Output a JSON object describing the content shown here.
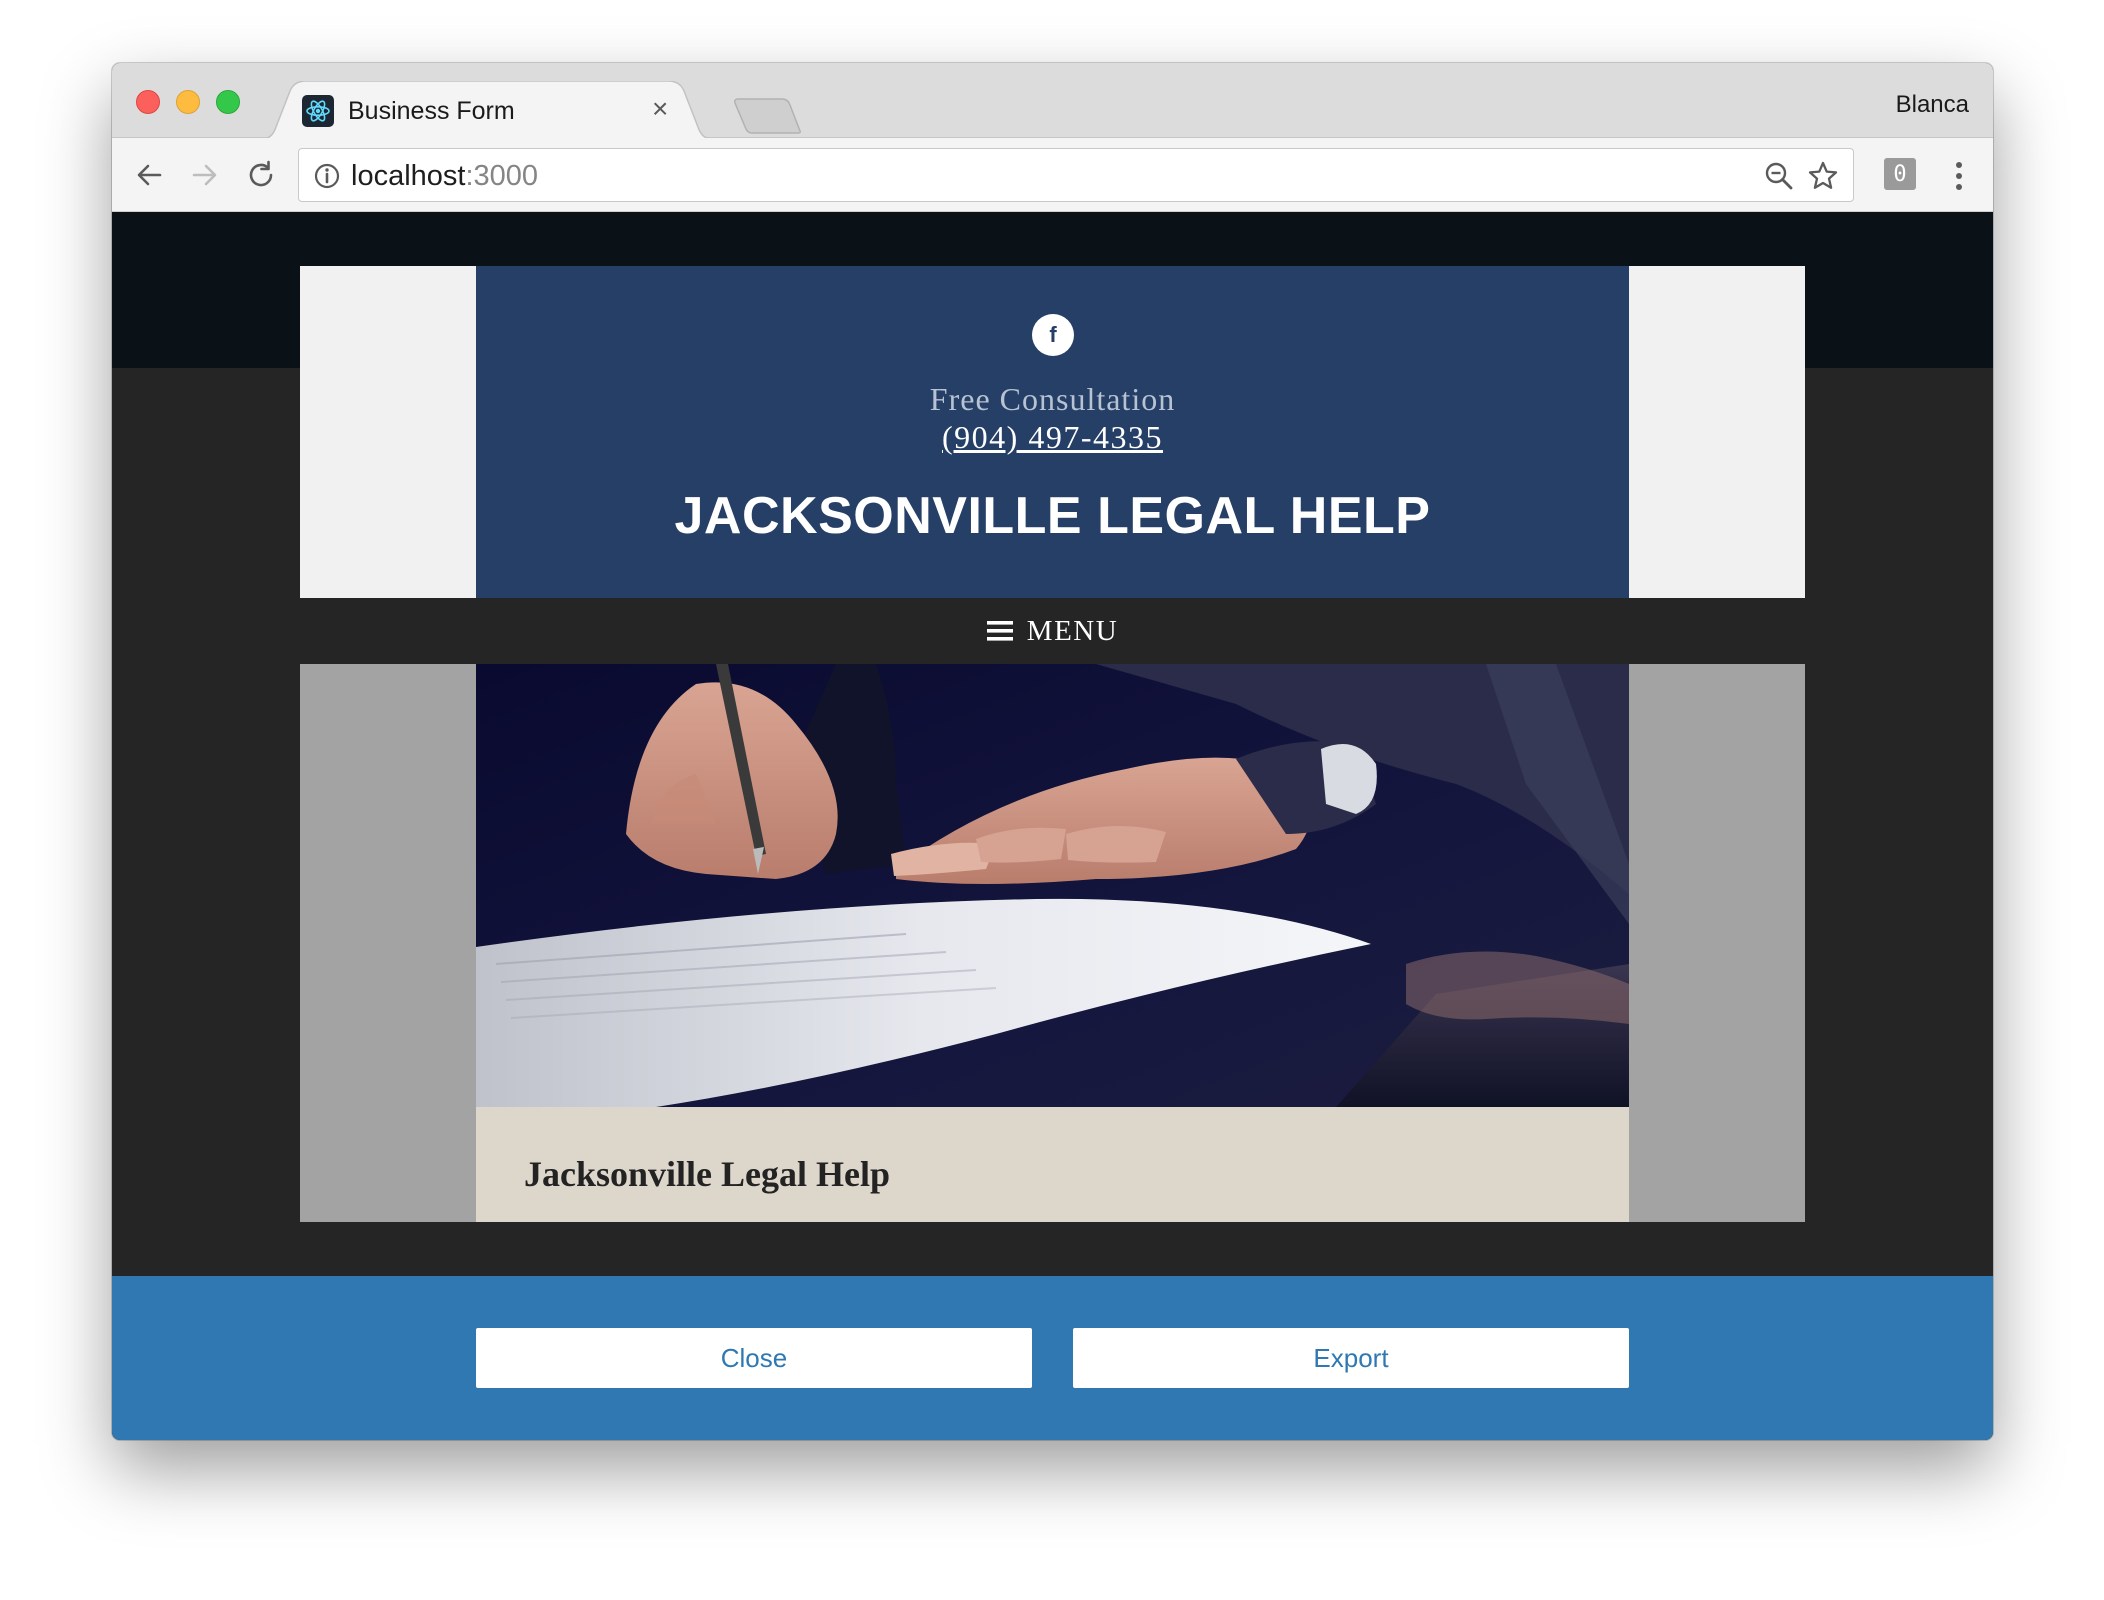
{
  "browser": {
    "tab_title": "Business Form",
    "tab_close_glyph": "×",
    "profile_name": "Blanca",
    "url_host": "localhost",
    "url_port": ":3000",
    "extension_badge": "0",
    "icons": [
      "back-icon",
      "forward-icon",
      "reload-icon",
      "info-icon",
      "zoom-out-icon",
      "star-icon",
      "react-favicon",
      "menu-dots-icon"
    ]
  },
  "site": {
    "social_icon_glyph": "f",
    "consultation_label": "Free Consultation",
    "phone": "(904) 497-4335",
    "title": "JACKSONVILLE LEGAL HELP",
    "menu_label": "MENU",
    "hero_caption": "Jacksonville Legal Help",
    "colors": {
      "header_blue": "#253f66",
      "footer_blue": "#2f78b2",
      "caption_beige": "#ddd6cb",
      "dark_background": "#252525"
    }
  },
  "footer": {
    "close_label": "Close",
    "export_label": "Export"
  }
}
